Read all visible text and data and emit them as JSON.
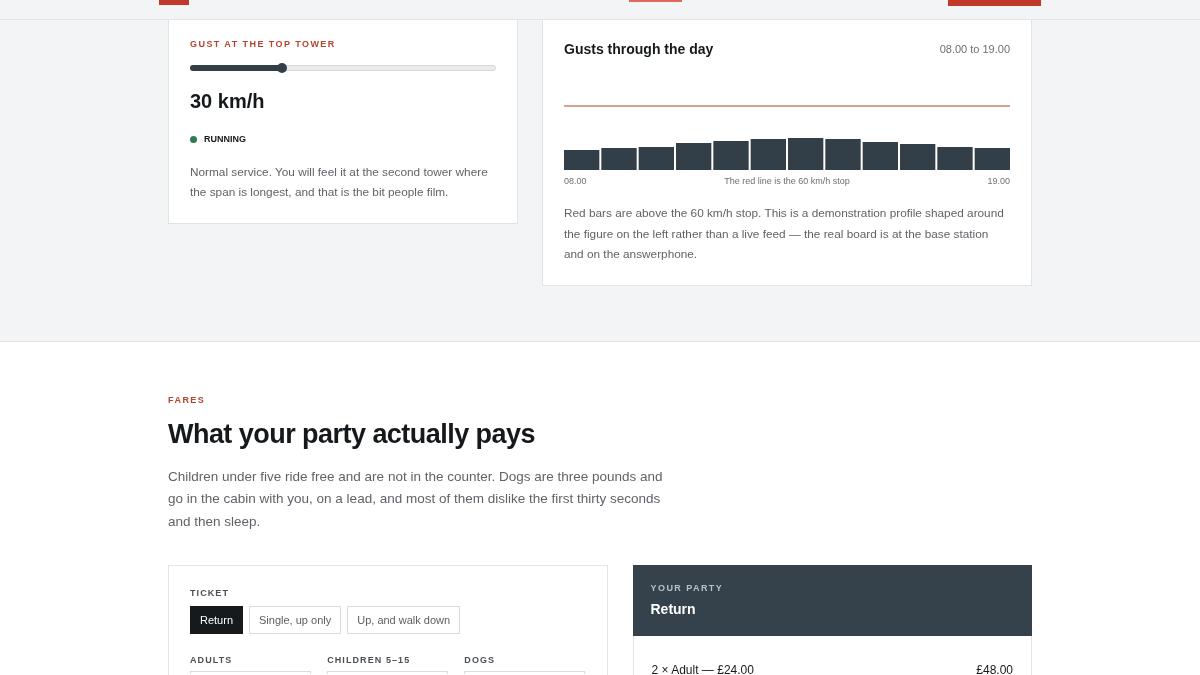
{
  "wind_card": {
    "label": "GUST AT THE TOP TOWER",
    "slider": {
      "level": 0.3
    },
    "reading": "30 km/h",
    "status": {
      "label": "RUNNING",
      "kind": "running"
    },
    "note": "Normal service. You will feel it at the second tower where the span is longest, and that is the bit people film."
  },
  "gust_chart": {
    "title": "Gusts through the day",
    "range": "08.00 to 19.00",
    "axis_start": "08.00",
    "caption": "The red line is the 60 km/h stop",
    "axis_end": "19.00",
    "note": "Red bars are above the 60 km/h stop. This is a demonstration profile shaped around the figure on the left rather than a live feed — the real board is at the base station and on the answerphone."
  },
  "fares": {
    "eyebrow": "FARES",
    "heading": "What your party actually pays",
    "intro": "Children under five ride free and are not in the counter. Dogs are three pounds and go in the cabin with you, on a lead, and most of them dislike the first thirty seconds and then sleep."
  },
  "ticket": {
    "label": "TICKET",
    "options": [
      {
        "label": "Return",
        "selected": true
      },
      {
        "label": "Single, up only",
        "selected": false
      },
      {
        "label": "Up, and walk down",
        "selected": false
      }
    ],
    "counters": [
      {
        "label": "ADULTS"
      },
      {
        "label": "CHILDREN 5–15"
      },
      {
        "label": "DOGS"
      }
    ]
  },
  "party": {
    "label": "YOUR PARTY",
    "ticket": "Return",
    "lines": [
      {
        "item": "2 × Adult — £24.00",
        "amount": "£48.00"
      }
    ]
  }
}
